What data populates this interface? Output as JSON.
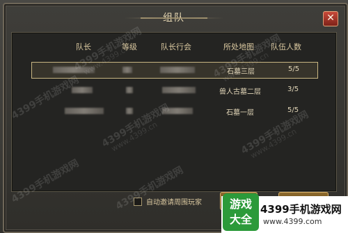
{
  "window": {
    "title": "组队",
    "close_glyph": "✕"
  },
  "table": {
    "headers": [
      "队长",
      "等级",
      "队长行会",
      "所处地图",
      "队伍人数"
    ],
    "rows": [
      {
        "map": "石墓三层",
        "count": "5/5",
        "selected": true
      },
      {
        "map": "兽人古墓二层",
        "count": "3/5",
        "selected": false
      },
      {
        "map": "石墓一层",
        "count": "5/5",
        "selected": false
      }
    ]
  },
  "footer": {
    "auto_invite_label": "自动邀请周围玩家"
  },
  "watermark": {
    "text": "4399手机游戏网",
    "url": "www.4399.cn"
  },
  "brand": {
    "badge_line1": "游戏",
    "badge_line2": "大全",
    "name": "4399手机游戏网",
    "url": "www.4399.com"
  },
  "colors": {
    "frame": "#6e6658",
    "text_gold": "#d9c79f",
    "close_red": "#c84a3a",
    "brand_green": "#2c9a3a"
  }
}
